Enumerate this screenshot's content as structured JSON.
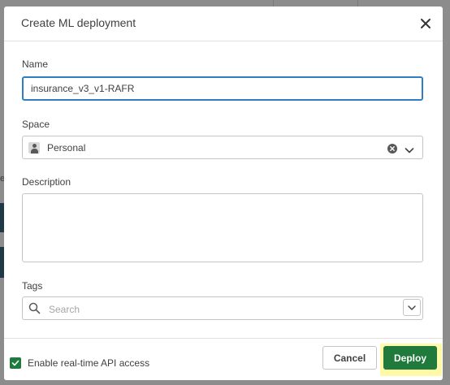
{
  "background": {
    "partial_text": "e"
  },
  "dialog": {
    "title": "Create ML deployment",
    "close_icon": "close-icon"
  },
  "name": {
    "label": "Name",
    "value": "insurance_v3_v1-RAFR"
  },
  "space": {
    "label": "Space",
    "value": "Personal",
    "icon": "person-icon"
  },
  "description": {
    "label": "Description",
    "value": ""
  },
  "tags": {
    "label": "Tags",
    "placeholder": "Search"
  },
  "footer": {
    "realtime_label": "Enable real-time API access",
    "realtime_checked": true,
    "cancel_label": "Cancel",
    "deploy_label": "Deploy"
  },
  "colors": {
    "primary_green": "#1f7a3b",
    "focus_blue": "#2f7ec2",
    "highlight_yellow": "#fff9a8"
  }
}
